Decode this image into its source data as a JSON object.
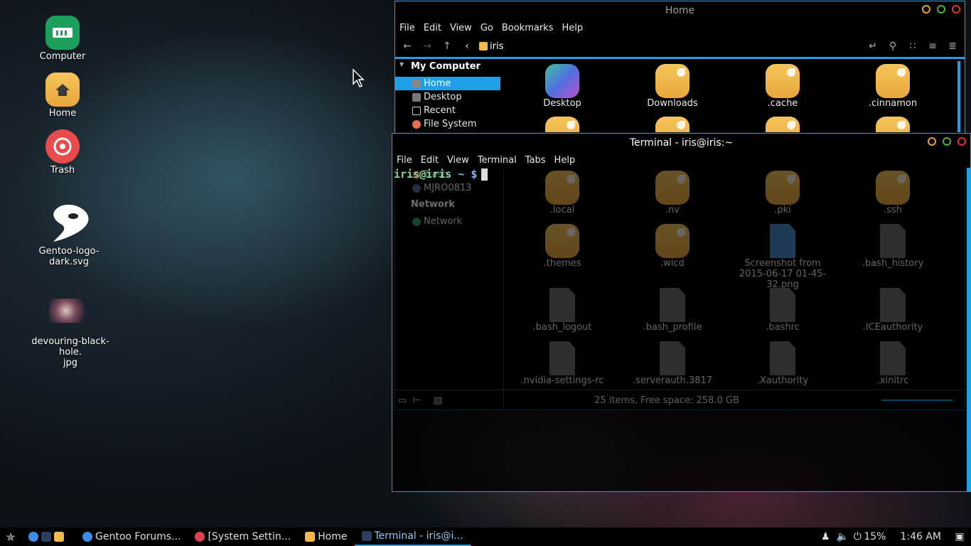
{
  "desktop": {
    "icons": [
      {
        "label": "Computer",
        "icon": "computer-icon"
      },
      {
        "label": "Home",
        "icon": "home-folder-icon"
      },
      {
        "label": "Trash",
        "icon": "trash-icon"
      },
      {
        "label": "Gentoo-logo-dark.svg",
        "icon": "gentoo-logo-icon"
      },
      {
        "label": "devouring-black-hole.\njpg",
        "icon": "image-thumbnail-icon"
      }
    ]
  },
  "file_manager": {
    "title": "Home",
    "menu": [
      "File",
      "Edit",
      "View",
      "Go",
      "Bookmarks",
      "Help"
    ],
    "location": "iris",
    "sidebar": {
      "my_computer_heading": "My Computer",
      "items": [
        "Home",
        "Desktop",
        "Recent",
        "File System",
        "Trash",
        "MJRO0813"
      ],
      "network_heading": "Network",
      "network_items": [
        "Network"
      ]
    },
    "files": [
      {
        "name": "Desktop",
        "kind": "desktop"
      },
      {
        "name": "Downloads",
        "kind": "folder"
      },
      {
        "name": ".cache",
        "kind": "folder"
      },
      {
        "name": ".cinnamon",
        "kind": "folder"
      },
      {
        "name": ".local",
        "kind": "folder"
      },
      {
        "name": ".nv",
        "kind": "folder"
      },
      {
        "name": ".pki",
        "kind": "folder"
      },
      {
        "name": ".ssh",
        "kind": "folder"
      },
      {
        "name": ".themes",
        "kind": "folder"
      },
      {
        "name": ".wicd",
        "kind": "folder"
      },
      {
        "name": "Screenshot from 2015-06-17 01-45-32.png",
        "kind": "image"
      },
      {
        "name": ".bash_history",
        "kind": "doc"
      },
      {
        "name": ".bash_logout",
        "kind": "doc"
      },
      {
        "name": ".bash_profile",
        "kind": "doc"
      },
      {
        "name": ".bashrc",
        "kind": "doc"
      },
      {
        "name": ".ICEauthority",
        "kind": "binary"
      },
      {
        "name": ".nvidia-settings-rc",
        "kind": "doc"
      },
      {
        "name": ".serverauth.3817",
        "kind": "binary"
      },
      {
        "name": ".Xauthority",
        "kind": "binary"
      },
      {
        "name": ".xinitrc",
        "kind": "locked"
      }
    ],
    "status": "25 items, Free space: 258.0 GB"
  },
  "terminal": {
    "title": "Terminal - iris@iris:~",
    "menu": [
      "File",
      "Edit",
      "View",
      "Terminal",
      "Tabs",
      "Help"
    ],
    "prompt_user": "iris@iris",
    "prompt_path": " ~ $"
  },
  "taskbar": {
    "tasks": [
      "Gentoo Forums...",
      "[System Settin...",
      "Home",
      "Terminal - iris@i..."
    ],
    "battery": "15%",
    "clock": "1:46 AM"
  },
  "colors": {
    "accent": "#1ea0e8",
    "folder": "#f2b84c",
    "close": "#e03030",
    "minimize": "#e8a030",
    "maximize": "#50b030"
  }
}
